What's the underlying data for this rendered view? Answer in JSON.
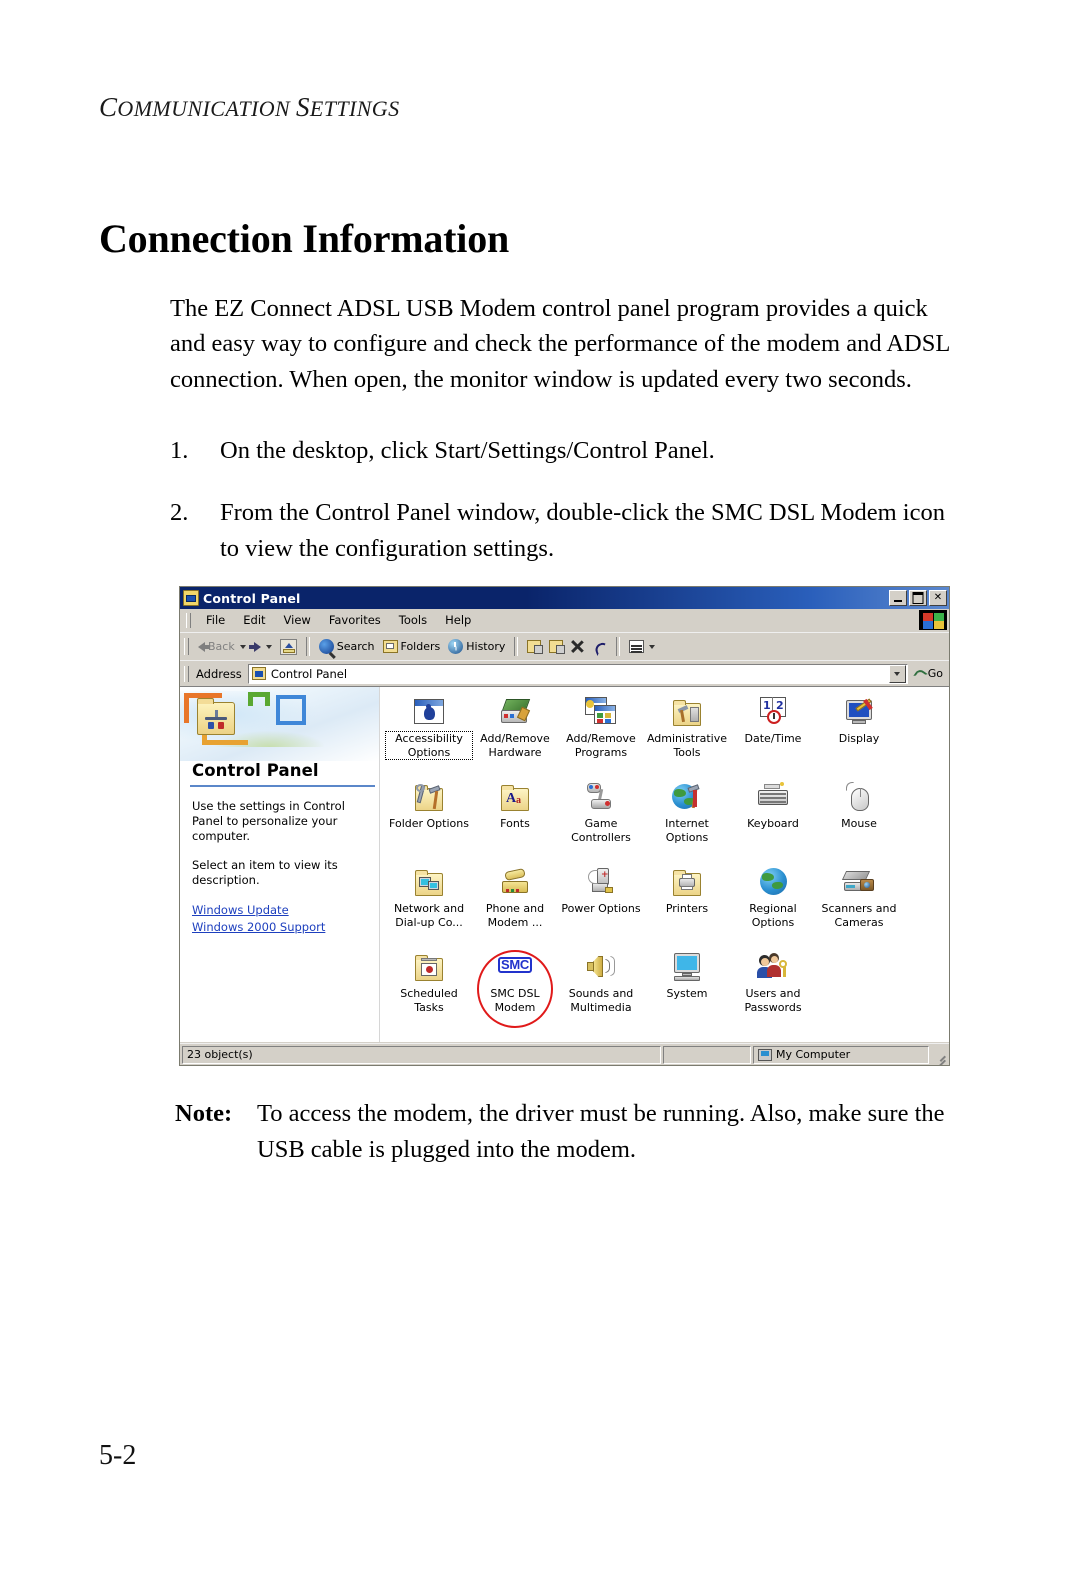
{
  "document": {
    "running_head": "Communication Settings",
    "title": "Connection Information",
    "intro_paragraph": "The EZ Connect ADSL USB Modem control panel program provides a quick and easy way to configure and check the performance of the modem and ADSL connection. When open, the monitor window is updated every two seconds.",
    "steps": [
      {
        "number": "1.",
        "text": "On the desktop, click Start/Settings/Control Panel."
      },
      {
        "number": "2.",
        "text": "From the Control Panel window, double-click the SMC DSL Modem icon to view the configuration settings."
      }
    ],
    "note": {
      "label": "Note:",
      "text": "To access the modem, the driver must be running. Also, make sure the USB cable is plugged into the modem."
    },
    "page_number": "5-2"
  },
  "screenshot": {
    "window": {
      "title": "Control Panel",
      "title_icon": "control-panel-folder-icon",
      "caption_buttons": [
        {
          "name": "minimize",
          "glyph": "_"
        },
        {
          "name": "maximize",
          "glyph": "□"
        },
        {
          "name": "close",
          "glyph": "✕"
        }
      ]
    },
    "menu": [
      "File",
      "Edit",
      "View",
      "Favorites",
      "Tools",
      "Help"
    ],
    "toolbar": [
      {
        "label": "Back",
        "icon": "back-arrow-icon",
        "has_dropdown": true,
        "disabled": true
      },
      {
        "label": "",
        "icon": "forward-arrow-icon",
        "has_dropdown": true,
        "disabled": true
      },
      {
        "label": "",
        "icon": "up-folder-icon",
        "has_dropdown": false,
        "disabled": false
      },
      {
        "label": "Search",
        "icon": "search-icon",
        "has_dropdown": false,
        "disabled": false
      },
      {
        "label": "Folders",
        "icon": "folders-icon",
        "has_dropdown": false,
        "disabled": false
      },
      {
        "label": "History",
        "icon": "history-icon",
        "has_dropdown": false,
        "disabled": false
      },
      {
        "label": "",
        "icon": "move-to-icon",
        "has_dropdown": false,
        "disabled": false
      },
      {
        "label": "",
        "icon": "copy-to-icon",
        "has_dropdown": false,
        "disabled": false
      },
      {
        "label": "",
        "icon": "delete-icon",
        "has_dropdown": false,
        "disabled": false
      },
      {
        "label": "",
        "icon": "undo-icon",
        "has_dropdown": false,
        "disabled": false
      },
      {
        "label": "",
        "icon": "views-icon",
        "has_dropdown": true,
        "disabled": false
      }
    ],
    "address_bar": {
      "label": "Address",
      "value": "Control Panel",
      "icon": "control-panel-folder-icon",
      "go_label": "Go"
    },
    "left_pane": {
      "heading": "Control Panel",
      "description_1": "Use the settings in Control Panel to personalize your computer.",
      "description_2": "Select an item to view its description.",
      "links": [
        "Windows Update",
        "Windows 2000 Support"
      ]
    },
    "items": [
      {
        "label": "Accessibility Options",
        "icon": "accessibility-icon",
        "focused": true,
        "circled": false
      },
      {
        "label": "Add/Remove Hardware",
        "icon": "add-remove-hardware-icon",
        "focused": false,
        "circled": false
      },
      {
        "label": "Add/Remove Programs",
        "icon": "add-remove-programs-icon",
        "focused": false,
        "circled": false
      },
      {
        "label": "Administrative Tools",
        "icon": "administrative-tools-icon",
        "focused": false,
        "circled": false
      },
      {
        "label": "Date/Time",
        "icon": "date-time-icon",
        "focused": false,
        "circled": false
      },
      {
        "label": "Display",
        "icon": "display-icon",
        "focused": false,
        "circled": false
      },
      {
        "label": "Folder Options",
        "icon": "folder-options-icon",
        "focused": false,
        "circled": false
      },
      {
        "label": "Fonts",
        "icon": "fonts-icon",
        "focused": false,
        "circled": false
      },
      {
        "label": "Game Controllers",
        "icon": "game-controllers-icon",
        "focused": false,
        "circled": false
      },
      {
        "label": "Internet Options",
        "icon": "internet-options-icon",
        "focused": false,
        "circled": false
      },
      {
        "label": "Keyboard",
        "icon": "keyboard-icon",
        "focused": false,
        "circled": false
      },
      {
        "label": "Mouse",
        "icon": "mouse-icon",
        "focused": false,
        "circled": false
      },
      {
        "label": "Network and Dial-up Co...",
        "icon": "network-dialup-icon",
        "focused": false,
        "circled": false
      },
      {
        "label": "Phone and Modem ...",
        "icon": "phone-modem-icon",
        "focused": false,
        "circled": false
      },
      {
        "label": "Power Options",
        "icon": "power-options-icon",
        "focused": false,
        "circled": false
      },
      {
        "label": "Printers",
        "icon": "printers-icon",
        "focused": false,
        "circled": false
      },
      {
        "label": "Regional Options",
        "icon": "regional-options-icon",
        "focused": false,
        "circled": false
      },
      {
        "label": "Scanners and Cameras",
        "icon": "scanners-cameras-icon",
        "focused": false,
        "circled": false
      },
      {
        "label": "Scheduled Tasks",
        "icon": "scheduled-tasks-icon",
        "focused": false,
        "circled": false
      },
      {
        "label": "SMC DSL Modem",
        "icon": "smc-dsl-modem-icon",
        "focused": false,
        "circled": true
      },
      {
        "label": "Sounds and Multimedia",
        "icon": "sounds-multimedia-icon",
        "focused": false,
        "circled": false
      },
      {
        "label": "System",
        "icon": "system-icon",
        "focused": false,
        "circled": false
      },
      {
        "label": "Users and Passwords",
        "icon": "users-passwords-icon",
        "focused": false,
        "circled": false
      }
    ],
    "status_bar": {
      "object_count": "23 object(s)",
      "middle": "",
      "zone": "My Computer"
    },
    "colors": {
      "titlebar_start": "#0a246a",
      "titlebar_end": "#5b88cf",
      "window_face": "#d4d0c8",
      "link": "#1d3fbe",
      "annotation_circle": "#e01a1a",
      "left_pane_rule": "#5b87c9",
      "smc_logo": "#2233cc"
    }
  }
}
